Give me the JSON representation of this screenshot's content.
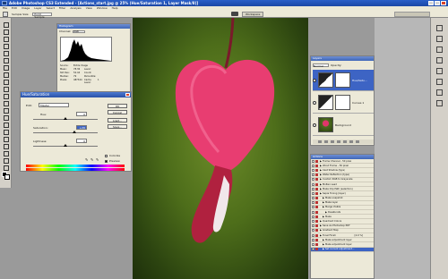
{
  "titlebar": {
    "title": "Adobe Photoshop CS3 Extended - [Actions_start.jpg @ 25% (Hue/Saturation 1, Layer Mask/8)]"
  },
  "menubar": {
    "items": [
      "File",
      "Edit",
      "Image",
      "Layer",
      "Select",
      "Filter",
      "Analysis",
      "View",
      "Window",
      "Help"
    ]
  },
  "optionsbar": {
    "sample_label": "Sample Size:",
    "sample_value": "Point Sample",
    "workspace_label": "Workspace"
  },
  "histogram": {
    "title": "Histogram",
    "channel_label": "Channel:",
    "channel_value": "RGB",
    "source_label": "Source:",
    "source_value": "Entire Image",
    "stats": [
      {
        "label": "Mean:",
        "value": "78.36",
        "label2": "Level:",
        "value2": ""
      },
      {
        "label": "Std Dev:",
        "value": "52.44",
        "label2": "Count:",
        "value2": ""
      },
      {
        "label": "Median:",
        "value": "79",
        "label2": "Percentile:",
        "value2": ""
      },
      {
        "label": "Pixels:",
        "value": "487344",
        "label2": "Cache Level:",
        "value2": "1"
      }
    ]
  },
  "huesat": {
    "title": "Hue/Saturation",
    "edit_label": "Edit:",
    "edit_value": "Master",
    "hue_label": "Hue:",
    "hue_value": "0",
    "saturation_label": "Saturation:",
    "saturation_value": "+26",
    "lightness_label": "Lightness:",
    "lightness_value": "0",
    "buttons": {
      "ok": "OK",
      "cancel": "Cancel",
      "load": "Load...",
      "save": "Save..."
    },
    "colorize_label": "Colorize",
    "preview_label": "Preview",
    "colorize_checked": false,
    "preview_checked": true
  },
  "layers": {
    "title": "Layers",
    "blend_mode": "Normal",
    "opacity_label": "Opacity:",
    "items": [
      {
        "name": "Hue/Satu...",
        "selected": true
      },
      {
        "name": "Curves 1",
        "selected": false
      },
      {
        "name": "Background",
        "selected": false
      }
    ]
  },
  "actions": {
    "title": "Actions",
    "items": [
      {
        "label": "Frame Channel - 50 pixel",
        "indent": 0,
        "selected": false
      },
      {
        "label": "Wood Frame - 50 pixel",
        "indent": 0,
        "selected": false
      },
      {
        "label": "Cast Shadow (type)",
        "indent": 0,
        "selected": false
      },
      {
        "label": "Water Reflection (type)",
        "indent": 0,
        "selected": false
      },
      {
        "label": "Custom RGB to Grayscale",
        "indent": 0,
        "selected": false
      },
      {
        "label": "Molten Lead",
        "indent": 0,
        "selected": false
      },
      {
        "label": "Make Clip Path (selection)",
        "indent": 0,
        "selected": false
      },
      {
        "label": "Sepia Toning (layer)",
        "indent": 0,
        "selected": false
      },
      {
        "label": "Make snapshot",
        "indent": 1,
        "selected": false
      },
      {
        "label": "Make layer",
        "indent": 1,
        "selected": false
      },
      {
        "label": "Merge Visible",
        "indent": 1,
        "selected": false
      },
      {
        "label": "Desaturate",
        "indent": 2,
        "selected": false
      },
      {
        "label": "Make",
        "indent": 1,
        "selected": false
      },
      {
        "label": "Quadrant Colors",
        "indent": 0,
        "selected": false
      },
      {
        "label": "Save As Photoshop PDF",
        "indent": 0,
        "selected": false
      },
      {
        "label": "Gradient Map",
        "indent": 0,
        "selected": false
      },
      {
        "label": "Tonal Finish",
        "indent": 0,
        "selected": false,
        "extra": "[4.0 %]"
      },
      {
        "label": "Make adjustment layer",
        "indent": 1,
        "selected": false
      },
      {
        "label": "Make adjustment layer",
        "indent": 1,
        "selected": false
      },
      {
        "label": "Set current adjustment...",
        "indent": 1,
        "selected": true
      }
    ]
  }
}
